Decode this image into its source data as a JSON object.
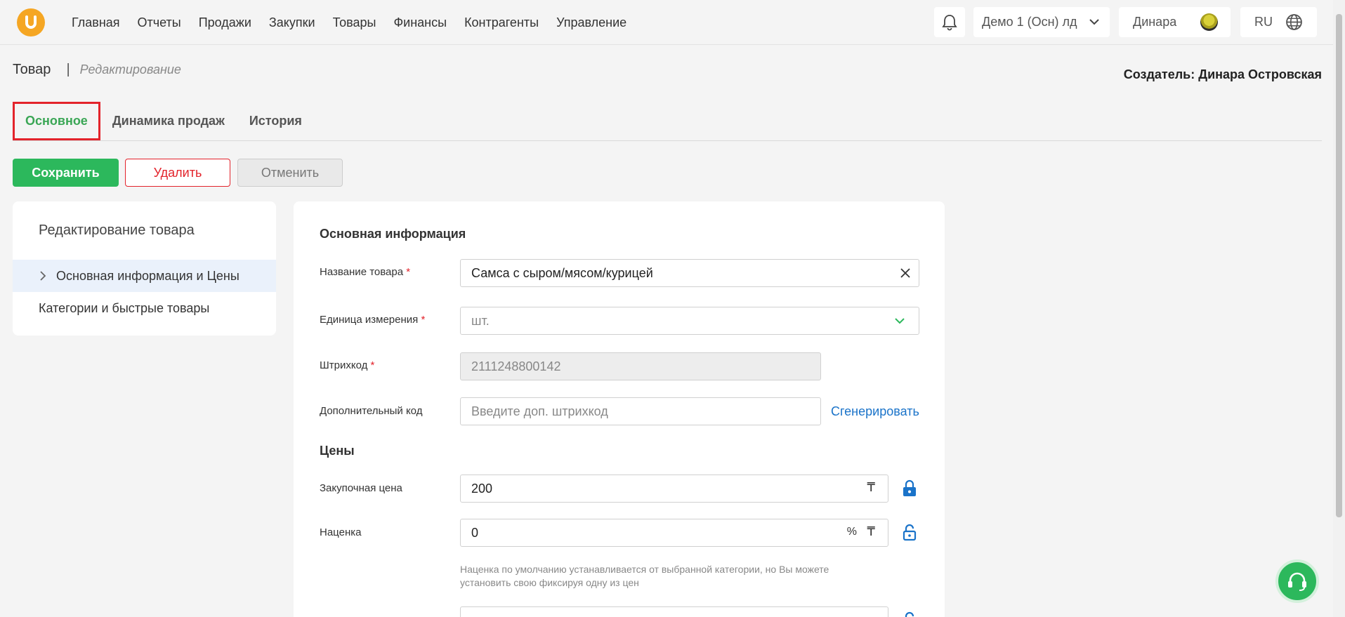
{
  "nav": {
    "items": [
      "Главная",
      "Отчеты",
      "Продажи",
      "Закупки",
      "Товары",
      "Финансы",
      "Контрагенты",
      "Управление"
    ]
  },
  "topbar": {
    "company": "Демо 1 (Осн) лд",
    "user": "Динара",
    "lang": "RU"
  },
  "breadcrumb": {
    "title": "Товар",
    "separator": "|",
    "subtitle": "Редактирование"
  },
  "creator": "Создатель: Динара Островская",
  "tabs": [
    "Основное",
    "Динамика продаж",
    "История"
  ],
  "buttons": {
    "save": "Сохранить",
    "delete": "Удалить",
    "cancel": "Отменить"
  },
  "sidebar": {
    "title": "Редактирование товара",
    "items": [
      "Основная информация и Цены",
      "Категории и быстрые товары"
    ]
  },
  "form": {
    "section_main": "Основная информация",
    "name_label": "Название товара",
    "name_value": "Самса с сыром/мясом/курицей",
    "unit_label": "Единица измерения",
    "unit_value": "шт.",
    "barcode_label": "Штрихкод",
    "barcode_value": "2111248800142",
    "extra_code_label": "Дополнительный код",
    "extra_code_placeholder": "Введите доп. штрихкод",
    "generate_link": "Сгенерировать",
    "section_prices": "Цены",
    "purchase_label": "Закупочная цена",
    "purchase_value": "200",
    "markup_label": "Наценка",
    "markup_value": "0",
    "markup_percent": "%",
    "currency": "₸",
    "markup_hint": "Наценка по умолчанию устанавливается от выбранной категории, но Вы можете установить свою фиксируя одну из цен",
    "required_mark": "*"
  },
  "colors": {
    "accent_green": "#2cb85c",
    "danger_red": "#e3232b",
    "link_blue": "#1a73c9",
    "logo_orange": "#f5a623"
  }
}
